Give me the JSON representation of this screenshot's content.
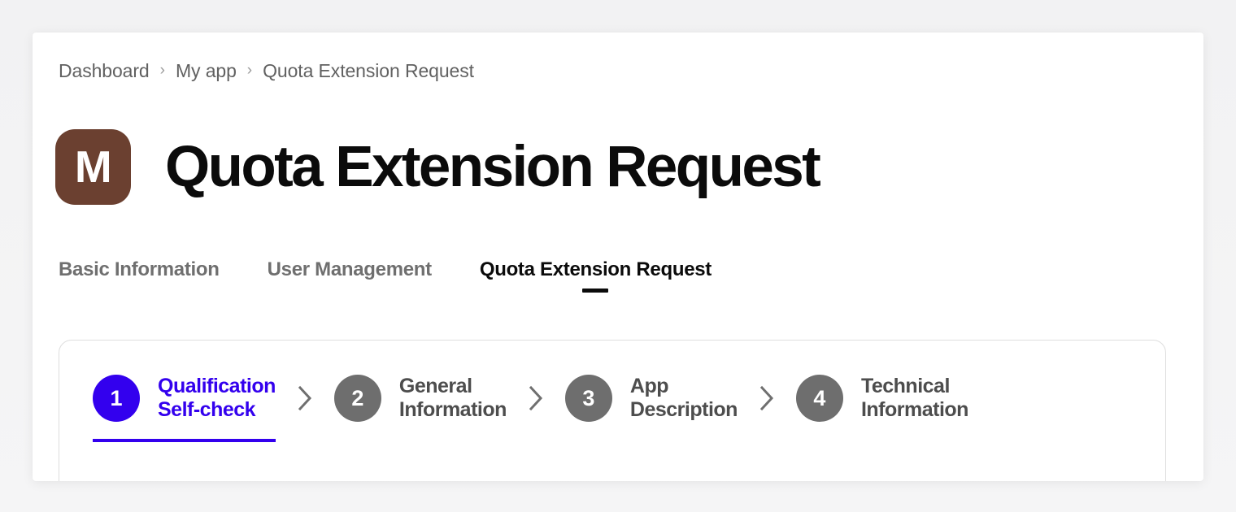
{
  "breadcrumb": {
    "separator": "›",
    "items": [
      {
        "label": "Dashboard"
      },
      {
        "label": "My app"
      },
      {
        "label": "Quota Extension Request"
      }
    ]
  },
  "header": {
    "avatar_letter": "M",
    "avatar_color": "#6b4030",
    "title": "Quota Extension Request"
  },
  "tabs": {
    "items": [
      {
        "label": "Basic Information",
        "active": false
      },
      {
        "label": "User Management",
        "active": false
      },
      {
        "label": "Quota Extension Request",
        "active": true
      }
    ]
  },
  "stepper": {
    "separator_icon": "chevron-right-icon",
    "active_color": "#3300ee",
    "inactive_color": "#6e6e6e",
    "steps": [
      {
        "number": "1",
        "label": "Qualification\nSelf-check",
        "active": true
      },
      {
        "number": "2",
        "label": "General\nInformation",
        "active": false
      },
      {
        "number": "3",
        "label": "App\nDescription",
        "active": false
      },
      {
        "number": "4",
        "label": "Technical\nInformation",
        "active": false
      }
    ]
  }
}
